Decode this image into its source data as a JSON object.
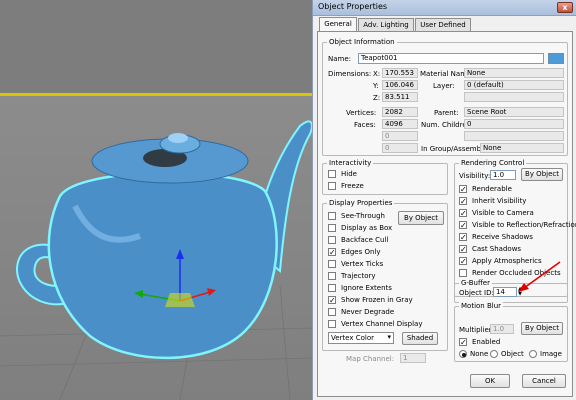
{
  "dialog": {
    "title": "Object Properties",
    "close_glyph": "x",
    "tabs": [
      {
        "label": "General",
        "active": true
      },
      {
        "label": "Adv. Lighting",
        "active": false
      },
      {
        "label": "User Defined",
        "active": false
      }
    ]
  },
  "object_info": {
    "title": "Object Information",
    "name_label": "Name:",
    "name_value": "Teapot001",
    "color_swatch": "#4f9bd8",
    "dimensions_label": "Dimensions:",
    "x_label": "X:",
    "x_value": "170.553",
    "y_label": "Y:",
    "y_value": "106.046",
    "z_label": "Z:",
    "z_value": "83.511",
    "vertices_label": "Vertices:",
    "vertices_value": "2082",
    "faces_label": "Faces:",
    "faces_value": "4096",
    "blank1": "0",
    "blank2": "0",
    "material_label": "Material Name:",
    "material_value": "None",
    "layer_label": "Layer:",
    "layer_value": "0 (default)",
    "parent_label": "Parent:",
    "parent_value": "Scene Root",
    "children_label": "Num. Children:",
    "children_value": "0",
    "group_label": "In Group/Assembly:",
    "group_value": "None"
  },
  "interactivity": {
    "title": "Interactivity",
    "items": [
      {
        "label": "Hide",
        "checked": false
      },
      {
        "label": "Freeze",
        "checked": false
      }
    ]
  },
  "display_properties": {
    "title": "Display Properties",
    "by_object": "By Object",
    "items": [
      {
        "label": "See-Through",
        "checked": false
      },
      {
        "label": "Display as Box",
        "checked": false
      },
      {
        "label": "Backface Cull",
        "checked": false
      },
      {
        "label": "Edges Only",
        "checked": true
      },
      {
        "label": "Vertex Ticks",
        "checked": false
      },
      {
        "label": "Trajectory",
        "checked": false
      },
      {
        "label": "Ignore Extents",
        "checked": false
      },
      {
        "label": "Show Frozen in Gray",
        "checked": true
      },
      {
        "label": "Never Degrade",
        "checked": false
      },
      {
        "label": "Vertex Channel Display",
        "checked": false
      }
    ],
    "vertex_color": "Vertex Color",
    "shaded": "Shaded",
    "map_channel_label": "Map Channel:",
    "map_channel_value": "1"
  },
  "rendering_control": {
    "title": "Rendering Control",
    "visibility_label": "Visibility:",
    "visibility_value": "1.0",
    "by_object": "By Object",
    "items": [
      {
        "label": "Renderable",
        "checked": true
      },
      {
        "label": "Inherit Visibility",
        "checked": true
      },
      {
        "label": "Visible to Camera",
        "checked": true
      },
      {
        "label": "Visible to Reflection/Refraction",
        "checked": true
      },
      {
        "label": "Receive Shadows",
        "checked": true
      },
      {
        "label": "Cast Shadows",
        "checked": true
      },
      {
        "label": "Apply Atmospherics",
        "checked": true
      },
      {
        "label": "Render Occluded Objects",
        "checked": false
      }
    ]
  },
  "gbuffer": {
    "title": "G-Buffer",
    "object_id_label": "Object ID:",
    "object_id_value": "14"
  },
  "motion_blur": {
    "title": "Motion Blur",
    "multiplier_label": "Multiplier:",
    "multiplier_value": "1.0",
    "by_object": "By Object",
    "enabled_label": "Enabled",
    "enabled_checked": true,
    "options": [
      {
        "label": "None",
        "selected": true
      },
      {
        "label": "Object",
        "selected": false
      },
      {
        "label": "Image",
        "selected": false
      }
    ]
  },
  "footer": {
    "ok": "OK",
    "cancel": "Cancel"
  },
  "colors": {
    "annotation_arrow": "#e00000",
    "teapot": "#4a8fc7",
    "teapot_outline": "#7ff5ff",
    "viewport_line": "#d9c500"
  }
}
